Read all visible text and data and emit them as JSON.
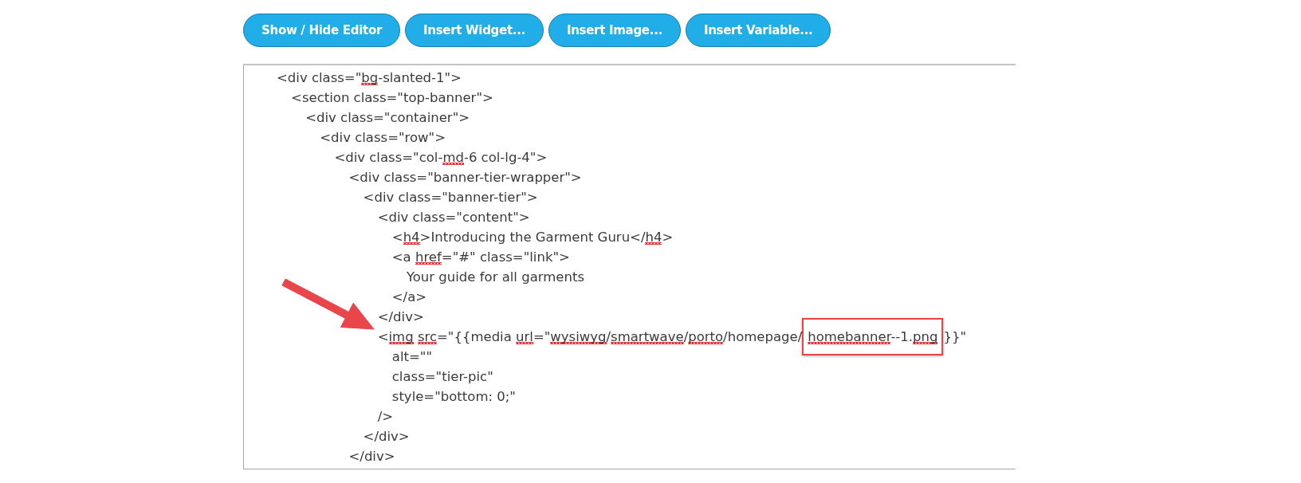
{
  "toolbar": {
    "buttons": [
      "Show / Hide Editor",
      "Insert Widget...",
      "Insert Image...",
      "Insert Variable..."
    ]
  },
  "editor": {
    "pointer_arrow": true,
    "lines": [
      {
        "segments": [
          {
            "text": "<div class=\"",
            "misspelled": false
          },
          {
            "text": "bg",
            "misspelled": true
          },
          {
            "text": "-slanted-1\">",
            "misspelled": false
          }
        ],
        "children": [
          {
            "segments": [
              {
                "text": "<section class=\"top-banner\">",
                "misspelled": false
              }
            ],
            "children": [
              {
                "segments": [
                  {
                    "text": "<div class=\"container\">",
                    "misspelled": false
                  }
                ],
                "children": [
                  {
                    "segments": [
                      {
                        "text": "<div class=\"row\">",
                        "misspelled": false
                      }
                    ],
                    "children": [
                      {
                        "segments": [
                          {
                            "text": "<div class=\"col-",
                            "misspelled": false
                          },
                          {
                            "text": "md",
                            "misspelled": true
                          },
                          {
                            "text": "-6 col-lg-4\">",
                            "misspelled": false
                          }
                        ],
                        "children": [
                          {
                            "segments": [
                              {
                                "text": "<div class=\"banner-tier-wrapper\">",
                                "misspelled": false
                              }
                            ],
                            "children": [
                              {
                                "segments": [
                                  {
                                    "text": "<div class=\"banner-tier\">",
                                    "misspelled": false
                                  }
                                ],
                                "children": [
                                  {
                                    "segments": [
                                      {
                                        "text": "<div class=\"content\">",
                                        "misspelled": false
                                      }
                                    ],
                                    "children": [
                                      {
                                        "segments": [
                                          {
                                            "text": "<",
                                            "misspelled": false
                                          },
                                          {
                                            "text": "h4",
                                            "misspelled": true
                                          },
                                          {
                                            "text": ">Introducing the Garment Guru</",
                                            "misspelled": false
                                          },
                                          {
                                            "text": "h4",
                                            "misspelled": true
                                          },
                                          {
                                            "text": ">",
                                            "misspelled": false
                                          }
                                        ]
                                      },
                                      {
                                        "segments": [
                                          {
                                            "text": "<a ",
                                            "misspelled": false
                                          },
                                          {
                                            "text": "href",
                                            "misspelled": true
                                          },
                                          {
                                            "text": "=\"#\" class=\"link\">",
                                            "misspelled": false
                                          }
                                        ],
                                        "children": [
                                          {
                                            "segments": [
                                              {
                                                "text": "Your guide for all garments",
                                                "misspelled": false
                                              }
                                            ]
                                          }
                                        ]
                                      },
                                      {
                                        "segments": [
                                          {
                                            "text": "</a>",
                                            "misspelled": false
                                          }
                                        ]
                                      }
                                    ]
                                  },
                                  {
                                    "segments": [
                                      {
                                        "text": "</div>",
                                        "misspelled": false
                                      }
                                    ]
                                  },
                                  {
                                    "segments": [
                                      {
                                        "text": "<",
                                        "misspelled": false,
                                        "boxed": false
                                      },
                                      {
                                        "text": "img",
                                        "misspelled": true,
                                        "boxed": false
                                      },
                                      {
                                        "text": " src",
                                        "misspelled": true,
                                        "boxed": false
                                      },
                                      {
                                        "text": "=\"{{media ",
                                        "misspelled": false,
                                        "boxed": false
                                      },
                                      {
                                        "text": "url",
                                        "misspelled": true,
                                        "boxed": false
                                      },
                                      {
                                        "text": "=\"",
                                        "misspelled": false,
                                        "boxed": false
                                      },
                                      {
                                        "text": "wysiwyg",
                                        "misspelled": true,
                                        "boxed": false
                                      },
                                      {
                                        "text": "/",
                                        "misspelled": false,
                                        "boxed": false
                                      },
                                      {
                                        "text": "smartwave",
                                        "misspelled": true,
                                        "boxed": false
                                      },
                                      {
                                        "text": "/",
                                        "misspelled": false,
                                        "boxed": false
                                      },
                                      {
                                        "text": "porto",
                                        "misspelled": true,
                                        "boxed": false
                                      },
                                      {
                                        "text": "/homepage/",
                                        "misspelled": false,
                                        "boxed": false
                                      },
                                      {
                                        "text": "homebanner",
                                        "misspelled": true,
                                        "boxed": true
                                      },
                                      {
                                        "text": "--1.",
                                        "misspelled": false,
                                        "boxed": true
                                      },
                                      {
                                        "text": "png",
                                        "misspelled": true,
                                        "boxed": true
                                      },
                                      {
                                        "text": "}}\"",
                                        "misspelled": false,
                                        "boxed": false
                                      }
                                    ],
                                    "children": [
                                      {
                                        "segments": [
                                          {
                                            "text": "alt=\"\"",
                                            "misspelled": false
                                          }
                                        ]
                                      },
                                      {
                                        "segments": [
                                          {
                                            "text": "class=\"tier-pic\"",
                                            "misspelled": false
                                          }
                                        ]
                                      },
                                      {
                                        "segments": [
                                          {
                                            "text": "style=\"bottom: 0;\"",
                                            "misspelled": false
                                          }
                                        ]
                                      }
                                    ]
                                  },
                                  {
                                    "segments": [
                                      {
                                        "text": "/>",
                                        "misspelled": false
                                      }
                                    ]
                                  }
                                ]
                              },
                              {
                                "segments": [
                                  {
                                    "text": "</div>",
                                    "misspelled": false
                                  }
                                ]
                              }
                            ]
                          },
                          {
                            "segments": [
                              {
                                "text": "</div>",
                                "misspelled": false
                              }
                            ]
                          }
                        ]
                      }
                    ]
                  }
                ]
              }
            ]
          }
        ]
      }
    ]
  }
}
